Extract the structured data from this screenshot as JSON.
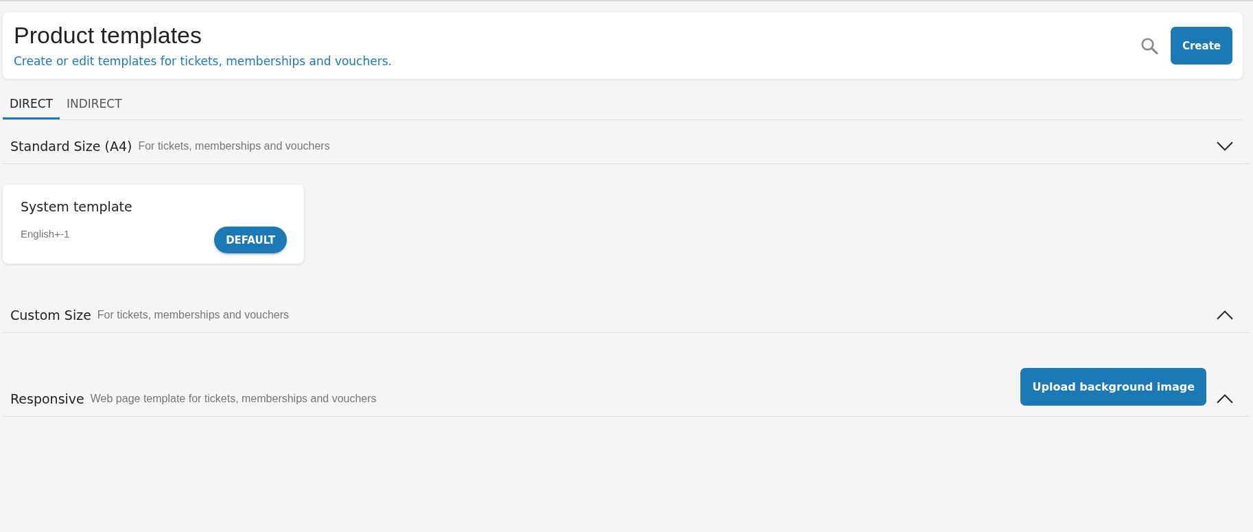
{
  "header": {
    "title": "Product templates",
    "subtitle": "Create or edit templates for tickets, memberships and vouchers.",
    "create_button": "Create"
  },
  "tabs": [
    {
      "label": "DIRECT",
      "selected": true
    },
    {
      "label": "INDIRECT",
      "selected": false
    }
  ],
  "sections": [
    {
      "title": "Standard Size (A4)",
      "description": "For tickets, memberships and vouchers",
      "expanded": true,
      "templates": [
        {
          "name": "System template",
          "language": "English+-1",
          "default_button": "DEFAULT"
        }
      ]
    },
    {
      "title": "Custom Size",
      "description": "For tickets, memberships and vouchers",
      "expanded": false
    },
    {
      "title": "Responsive",
      "description": "Web page template for tickets, memberships and vouchers",
      "action_button": "Upload background image",
      "expanded": false
    }
  ]
}
